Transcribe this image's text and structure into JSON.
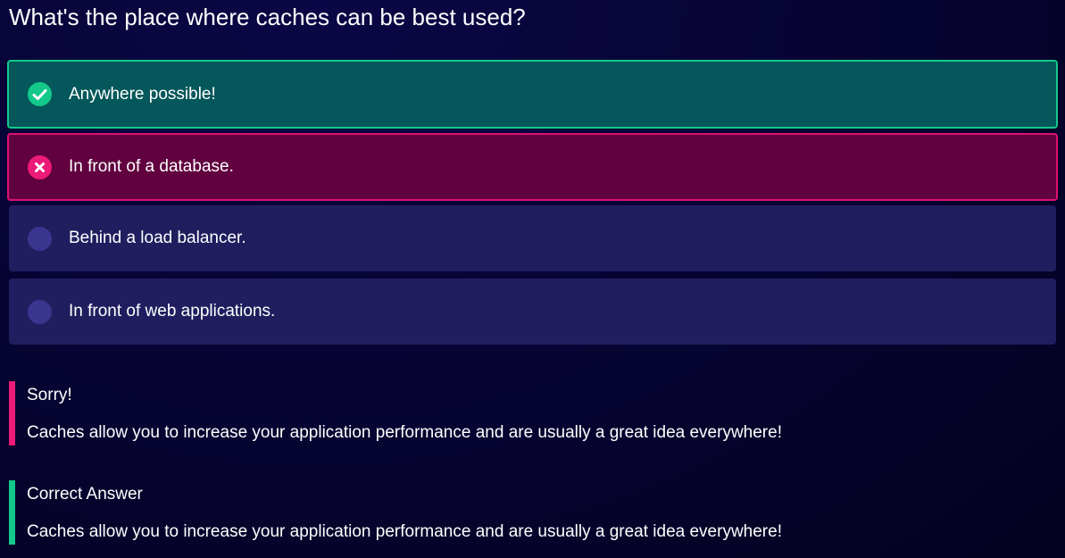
{
  "question": "What's the place where caches can be best used?",
  "options": [
    {
      "label": "Anywhere possible!",
      "state": "correct",
      "icon": "check-icon"
    },
    {
      "label": "In front of a database.",
      "state": "wrong",
      "icon": "cross-icon"
    },
    {
      "label": "Behind a load balancer.",
      "state": "neutral",
      "icon": "empty-circle-icon"
    },
    {
      "label": "In front of web applications.",
      "state": "neutral",
      "icon": "empty-circle-icon"
    }
  ],
  "feedback": {
    "sorry": {
      "title": "Sorry!",
      "text": "Caches allow you to increase your application performance and are usually a great idea everywhere!",
      "color": "#ec1a78"
    },
    "correct": {
      "title": "Correct Answer",
      "text": "Caches allow you to increase your application performance and are usually a great idea everywhere!",
      "color": "#13c98a"
    }
  },
  "colors": {
    "correct_bg": "#04575a",
    "correct_border": "#12c98b",
    "wrong_bg": "#61013f",
    "wrong_border": "#e0106f",
    "neutral_bg": "#201e5f",
    "background": "#070435"
  }
}
